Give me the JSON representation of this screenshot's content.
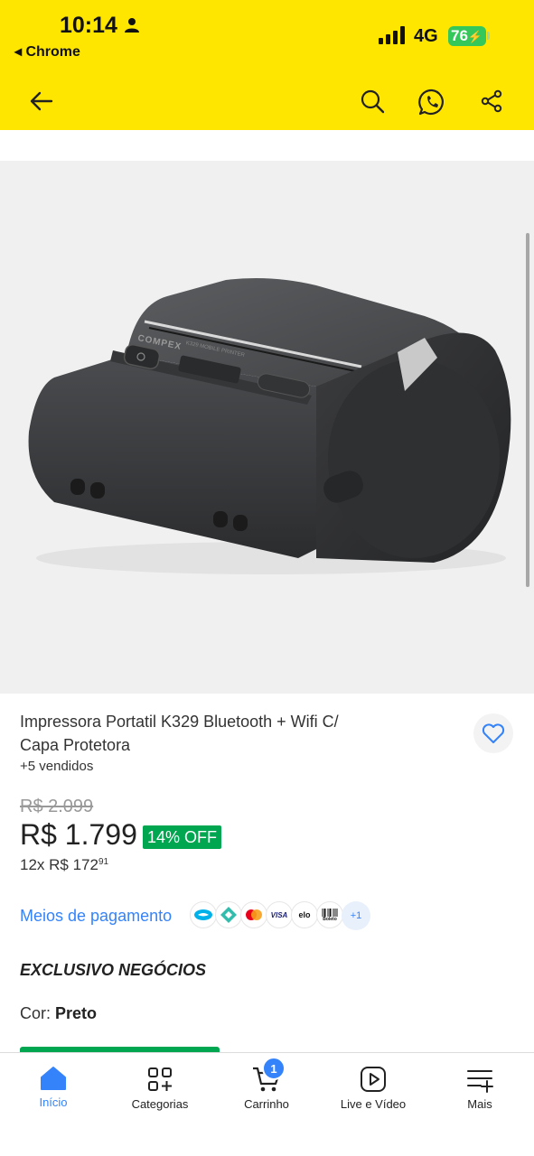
{
  "status_bar": {
    "time": "10:14",
    "back_app": "◂ Chrome",
    "network": "4G",
    "battery": "76"
  },
  "header": {
    "icons": [
      "arrow-left-icon",
      "search-icon",
      "whatsapp-icon",
      "share-icon"
    ]
  },
  "colors": {
    "header_bg": "#ffe600",
    "link": "#3483fa",
    "discount": "#00a650",
    "product_image_bg": "#f0f0f0"
  },
  "product": {
    "image_alt": "COMPEX",
    "image_model_text": "K329 MOBILE PRINTER",
    "title": "Impressora Portatil K329 Bluetooth + Wifi C/ Capa Protetora",
    "sold": "+5 vendidos",
    "old_price": "R$ 2.099",
    "price": "R$ 1.799",
    "discount": "14% OFF",
    "installments_prefix": "12x R$ 172",
    "installments_cents": "91",
    "payment_link": "Meios de pagamento",
    "payment_icons": [
      "mercado-pago",
      "pix",
      "mastercard",
      "visa",
      "elo",
      "boleto"
    ],
    "payment_labels": {
      "visa": "VISA",
      "elo": "elo",
      "boleto": "Boleto"
    },
    "payment_more": "+1",
    "exclusive": "EXCLUSIVO NEGÓCIOS",
    "color_label": "Cor:",
    "color_value": "Preto"
  },
  "bottom_nav": {
    "items": [
      {
        "label": "Início",
        "icon": "home-icon",
        "active": true
      },
      {
        "label": "Categorias",
        "icon": "categories-icon",
        "active": false
      },
      {
        "label": "Carrinho",
        "icon": "cart-icon",
        "active": false
      },
      {
        "label": "Live e Vídeo",
        "icon": "play-icon",
        "active": false
      },
      {
        "label": "Mais",
        "icon": "menu-plus-icon",
        "active": false
      }
    ],
    "cart_count": "1"
  }
}
